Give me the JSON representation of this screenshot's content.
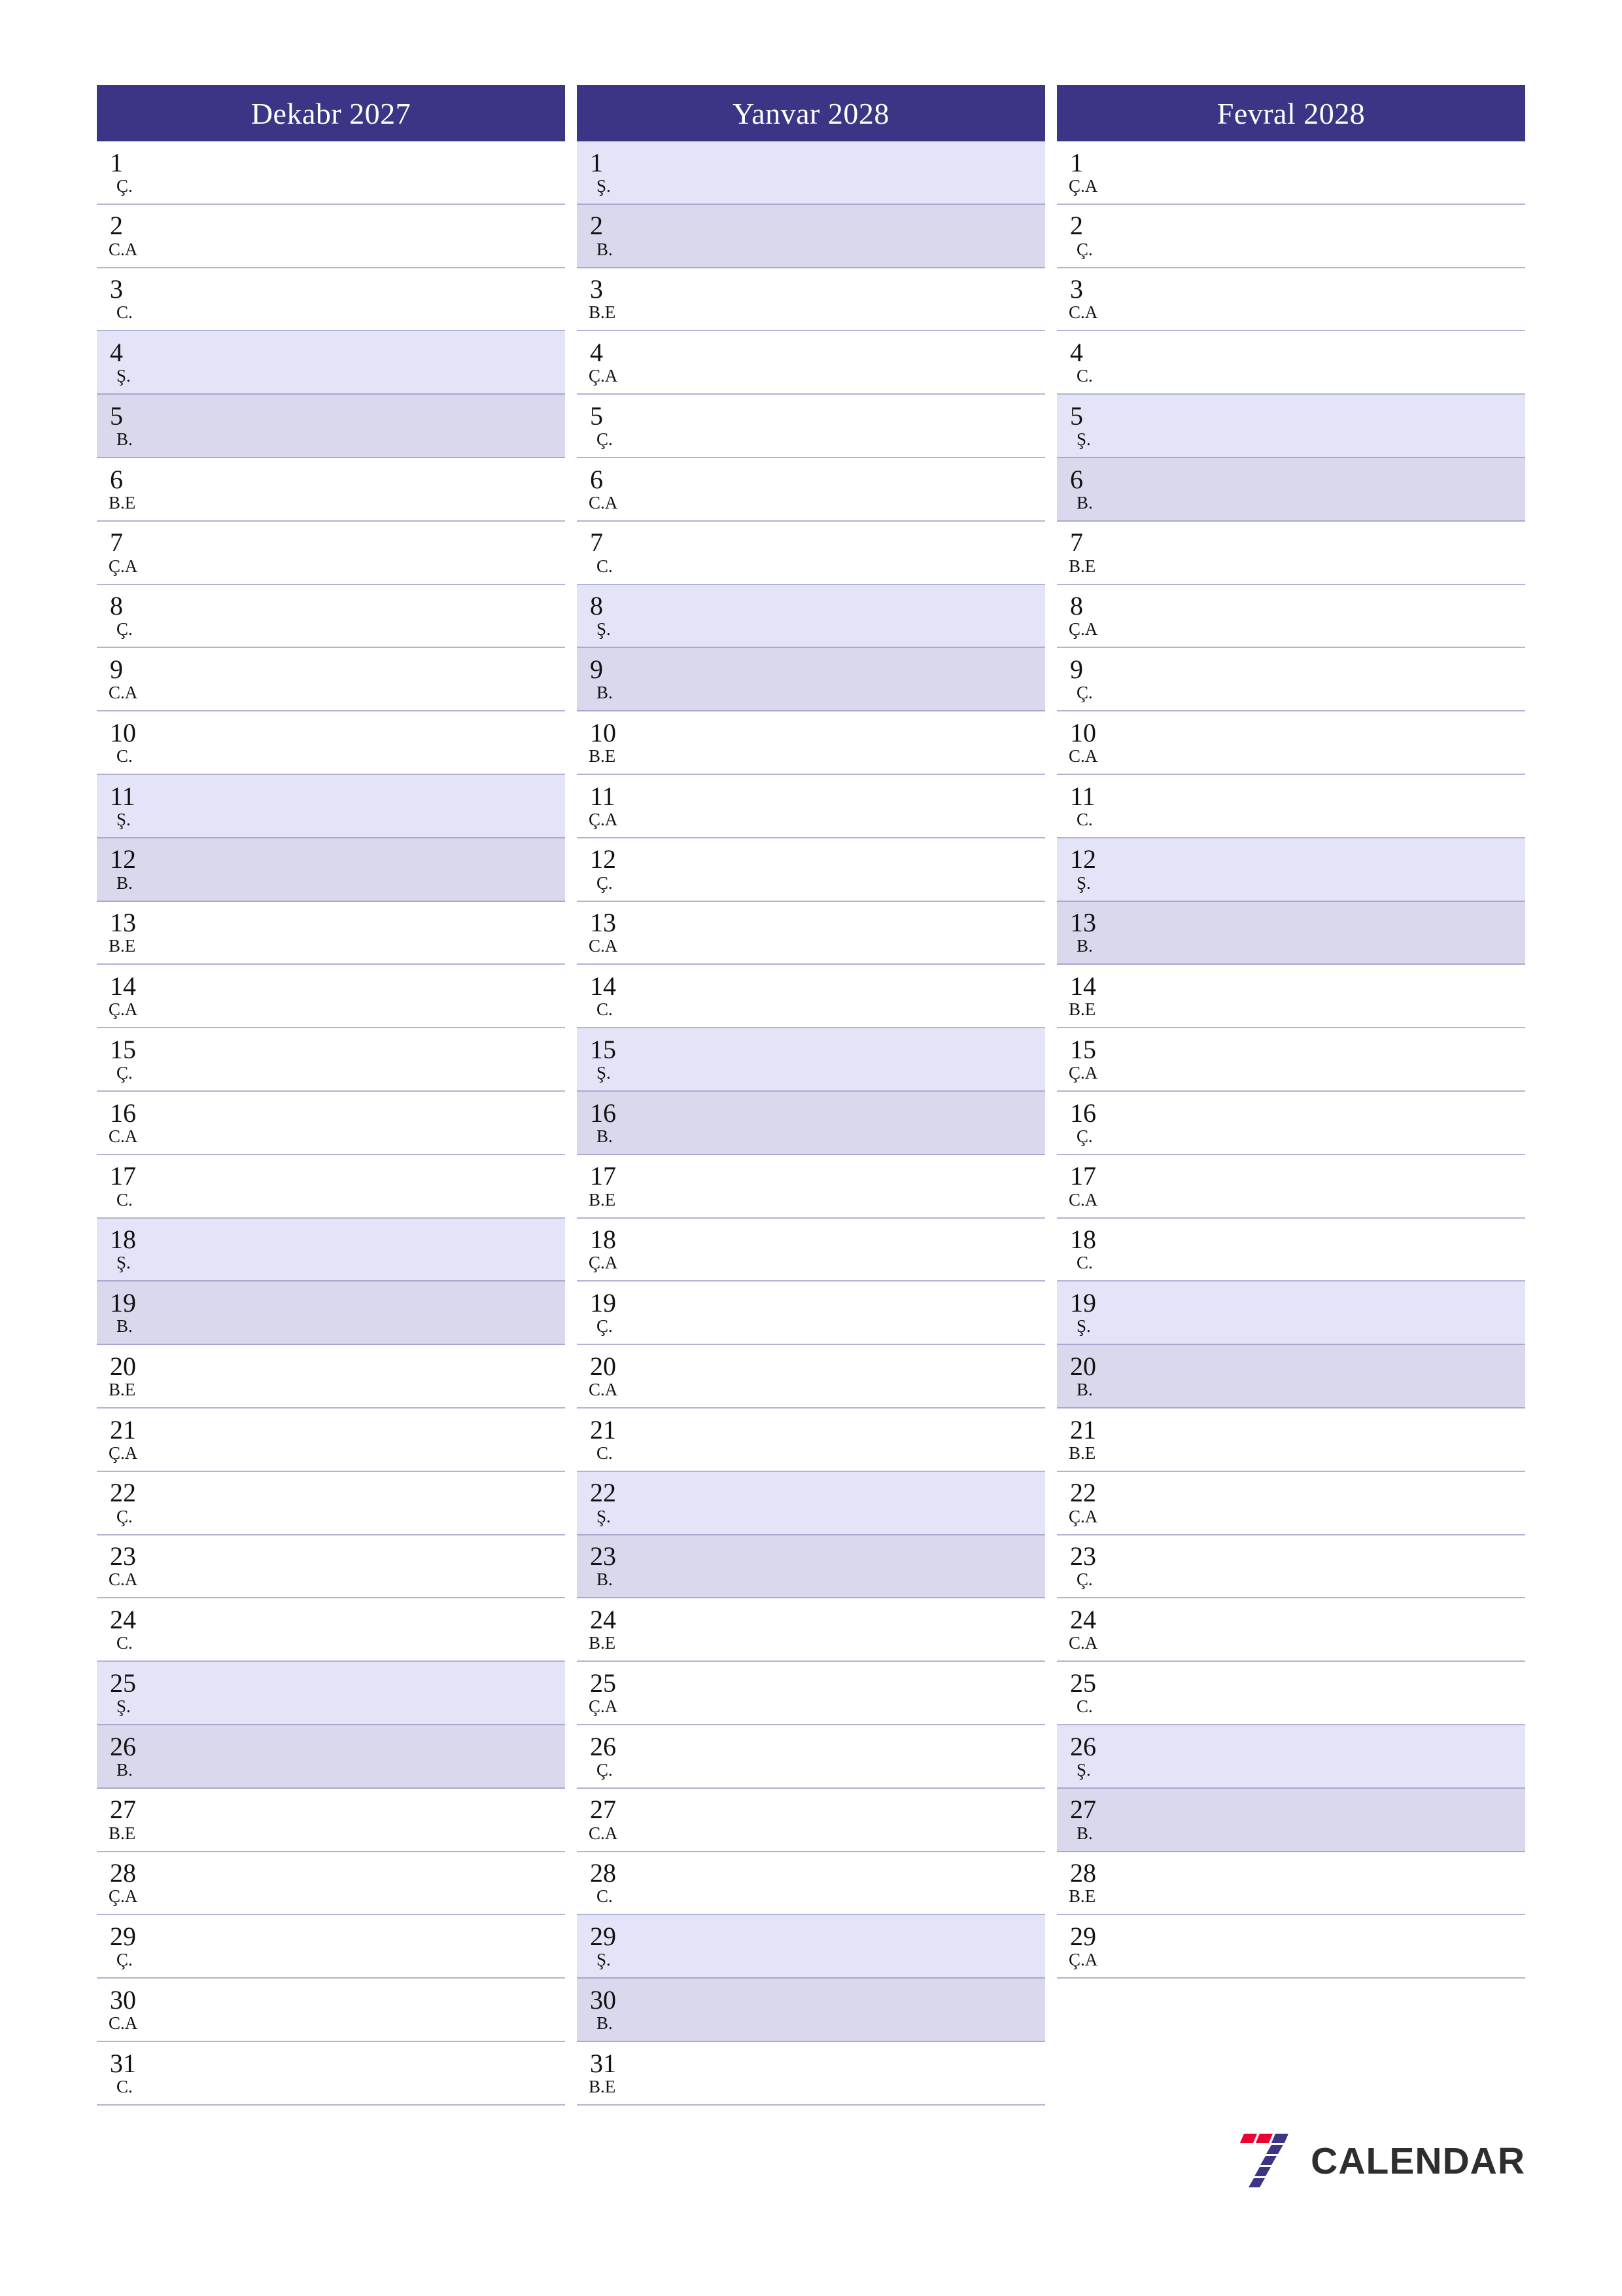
{
  "page": {
    "title": "Calendar planner 3 months",
    "accent_color": "#3c3585",
    "saturday_color": "#e3e4f7",
    "sunday_color": "#dad8ec",
    "separator_color": "#b3b2d4"
  },
  "brand": {
    "name": "CALENDAR",
    "mark": "seven-logo-icon",
    "mark_colors": [
      "#ee0033",
      "#3c3585"
    ]
  },
  "months": [
    {
      "title": "Dekabr 2027",
      "days": [
        {
          "num": "1",
          "wd": "Ç.",
          "type": "weekday"
        },
        {
          "num": "2",
          "wd": "C.A",
          "type": "weekday"
        },
        {
          "num": "3",
          "wd": "C.",
          "type": "weekday"
        },
        {
          "num": "4",
          "wd": "Ş.",
          "type": "sat"
        },
        {
          "num": "5",
          "wd": "B.",
          "type": "sun"
        },
        {
          "num": "6",
          "wd": "B.E",
          "type": "weekday"
        },
        {
          "num": "7",
          "wd": "Ç.A",
          "type": "weekday"
        },
        {
          "num": "8",
          "wd": "Ç.",
          "type": "weekday"
        },
        {
          "num": "9",
          "wd": "C.A",
          "type": "weekday"
        },
        {
          "num": "10",
          "wd": "C.",
          "type": "weekday"
        },
        {
          "num": "11",
          "wd": "Ş.",
          "type": "sat"
        },
        {
          "num": "12",
          "wd": "B.",
          "type": "sun"
        },
        {
          "num": "13",
          "wd": "B.E",
          "type": "weekday"
        },
        {
          "num": "14",
          "wd": "Ç.A",
          "type": "weekday"
        },
        {
          "num": "15",
          "wd": "Ç.",
          "type": "weekday"
        },
        {
          "num": "16",
          "wd": "C.A",
          "type": "weekday"
        },
        {
          "num": "17",
          "wd": "C.",
          "type": "weekday"
        },
        {
          "num": "18",
          "wd": "Ş.",
          "type": "sat"
        },
        {
          "num": "19",
          "wd": "B.",
          "type": "sun"
        },
        {
          "num": "20",
          "wd": "B.E",
          "type": "weekday"
        },
        {
          "num": "21",
          "wd": "Ç.A",
          "type": "weekday"
        },
        {
          "num": "22",
          "wd": "Ç.",
          "type": "weekday"
        },
        {
          "num": "23",
          "wd": "C.A",
          "type": "weekday"
        },
        {
          "num": "24",
          "wd": "C.",
          "type": "weekday"
        },
        {
          "num": "25",
          "wd": "Ş.",
          "type": "sat"
        },
        {
          "num": "26",
          "wd": "B.",
          "type": "sun"
        },
        {
          "num": "27",
          "wd": "B.E",
          "type": "weekday"
        },
        {
          "num": "28",
          "wd": "Ç.A",
          "type": "weekday"
        },
        {
          "num": "29",
          "wd": "Ç.",
          "type": "weekday"
        },
        {
          "num": "30",
          "wd": "C.A",
          "type": "weekday"
        },
        {
          "num": "31",
          "wd": "C.",
          "type": "weekday"
        }
      ]
    },
    {
      "title": "Yanvar 2028",
      "days": [
        {
          "num": "1",
          "wd": "Ş.",
          "type": "sat"
        },
        {
          "num": "2",
          "wd": "B.",
          "type": "sun"
        },
        {
          "num": "3",
          "wd": "B.E",
          "type": "weekday"
        },
        {
          "num": "4",
          "wd": "Ç.A",
          "type": "weekday"
        },
        {
          "num": "5",
          "wd": "Ç.",
          "type": "weekday"
        },
        {
          "num": "6",
          "wd": "C.A",
          "type": "weekday"
        },
        {
          "num": "7",
          "wd": "C.",
          "type": "weekday"
        },
        {
          "num": "8",
          "wd": "Ş.",
          "type": "sat"
        },
        {
          "num": "9",
          "wd": "B.",
          "type": "sun"
        },
        {
          "num": "10",
          "wd": "B.E",
          "type": "weekday"
        },
        {
          "num": "11",
          "wd": "Ç.A",
          "type": "weekday"
        },
        {
          "num": "12",
          "wd": "Ç.",
          "type": "weekday"
        },
        {
          "num": "13",
          "wd": "C.A",
          "type": "weekday"
        },
        {
          "num": "14",
          "wd": "C.",
          "type": "weekday"
        },
        {
          "num": "15",
          "wd": "Ş.",
          "type": "sat"
        },
        {
          "num": "16",
          "wd": "B.",
          "type": "sun"
        },
        {
          "num": "17",
          "wd": "B.E",
          "type": "weekday"
        },
        {
          "num": "18",
          "wd": "Ç.A",
          "type": "weekday"
        },
        {
          "num": "19",
          "wd": "Ç.",
          "type": "weekday"
        },
        {
          "num": "20",
          "wd": "C.A",
          "type": "weekday"
        },
        {
          "num": "21",
          "wd": "C.",
          "type": "weekday"
        },
        {
          "num": "22",
          "wd": "Ş.",
          "type": "sat"
        },
        {
          "num": "23",
          "wd": "B.",
          "type": "sun"
        },
        {
          "num": "24",
          "wd": "B.E",
          "type": "weekday"
        },
        {
          "num": "25",
          "wd": "Ç.A",
          "type": "weekday"
        },
        {
          "num": "26",
          "wd": "Ç.",
          "type": "weekday"
        },
        {
          "num": "27",
          "wd": "C.A",
          "type": "weekday"
        },
        {
          "num": "28",
          "wd": "C.",
          "type": "weekday"
        },
        {
          "num": "29",
          "wd": "Ş.",
          "type": "sat"
        },
        {
          "num": "30",
          "wd": "B.",
          "type": "sun"
        },
        {
          "num": "31",
          "wd": "B.E",
          "type": "weekday"
        }
      ]
    },
    {
      "title": "Fevral 2028",
      "days": [
        {
          "num": "1",
          "wd": "Ç.A",
          "type": "weekday"
        },
        {
          "num": "2",
          "wd": "Ç.",
          "type": "weekday"
        },
        {
          "num": "3",
          "wd": "C.A",
          "type": "weekday"
        },
        {
          "num": "4",
          "wd": "C.",
          "type": "weekday"
        },
        {
          "num": "5",
          "wd": "Ş.",
          "type": "sat"
        },
        {
          "num": "6",
          "wd": "B.",
          "type": "sun"
        },
        {
          "num": "7",
          "wd": "B.E",
          "type": "weekday"
        },
        {
          "num": "8",
          "wd": "Ç.A",
          "type": "weekday"
        },
        {
          "num": "9",
          "wd": "Ç.",
          "type": "weekday"
        },
        {
          "num": "10",
          "wd": "C.A",
          "type": "weekday"
        },
        {
          "num": "11",
          "wd": "C.",
          "type": "weekday"
        },
        {
          "num": "12",
          "wd": "Ş.",
          "type": "sat"
        },
        {
          "num": "13",
          "wd": "B.",
          "type": "sun"
        },
        {
          "num": "14",
          "wd": "B.E",
          "type": "weekday"
        },
        {
          "num": "15",
          "wd": "Ç.A",
          "type": "weekday"
        },
        {
          "num": "16",
          "wd": "Ç.",
          "type": "weekday"
        },
        {
          "num": "17",
          "wd": "C.A",
          "type": "weekday"
        },
        {
          "num": "18",
          "wd": "C.",
          "type": "weekday"
        },
        {
          "num": "19",
          "wd": "Ş.",
          "type": "sat"
        },
        {
          "num": "20",
          "wd": "B.",
          "type": "sun"
        },
        {
          "num": "21",
          "wd": "B.E",
          "type": "weekday"
        },
        {
          "num": "22",
          "wd": "Ç.A",
          "type": "weekday"
        },
        {
          "num": "23",
          "wd": "Ç.",
          "type": "weekday"
        },
        {
          "num": "24",
          "wd": "C.A",
          "type": "weekday"
        },
        {
          "num": "25",
          "wd": "C.",
          "type": "weekday"
        },
        {
          "num": "26",
          "wd": "Ş.",
          "type": "sat"
        },
        {
          "num": "27",
          "wd": "B.",
          "type": "sun"
        },
        {
          "num": "28",
          "wd": "B.E",
          "type": "weekday"
        },
        {
          "num": "29",
          "wd": "Ç.A",
          "type": "weekday"
        }
      ]
    }
  ]
}
